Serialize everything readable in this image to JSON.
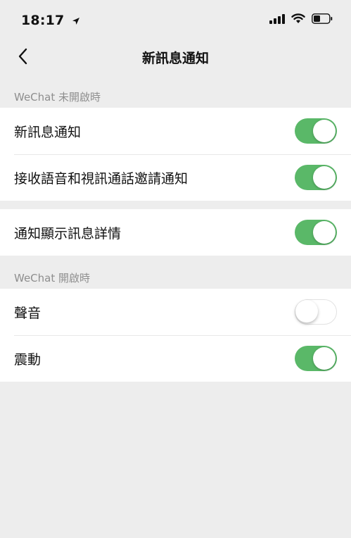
{
  "status_bar": {
    "time": "18:17",
    "icons": [
      "location-arrow-icon",
      "signal-icon",
      "wifi-icon",
      "battery-icon"
    ]
  },
  "nav": {
    "title": "新訊息通知",
    "back_icon": "chevron-left-icon"
  },
  "sections": [
    {
      "header": "WeChat 未開啟時",
      "rows": [
        {
          "label": "新訊息通知",
          "on": true
        },
        {
          "label": "接收語音和視訊通話邀請通知",
          "on": true
        }
      ]
    },
    {
      "header": "",
      "rows": [
        {
          "label": "通知顯示訊息詳情",
          "on": true
        }
      ]
    },
    {
      "header": "WeChat 開啟時",
      "rows": [
        {
          "label": "聲音",
          "on": false
        },
        {
          "label": "震動",
          "on": true
        }
      ]
    }
  ],
  "colors": {
    "toggle_on": "#5ab868",
    "background": "#ededed"
  }
}
